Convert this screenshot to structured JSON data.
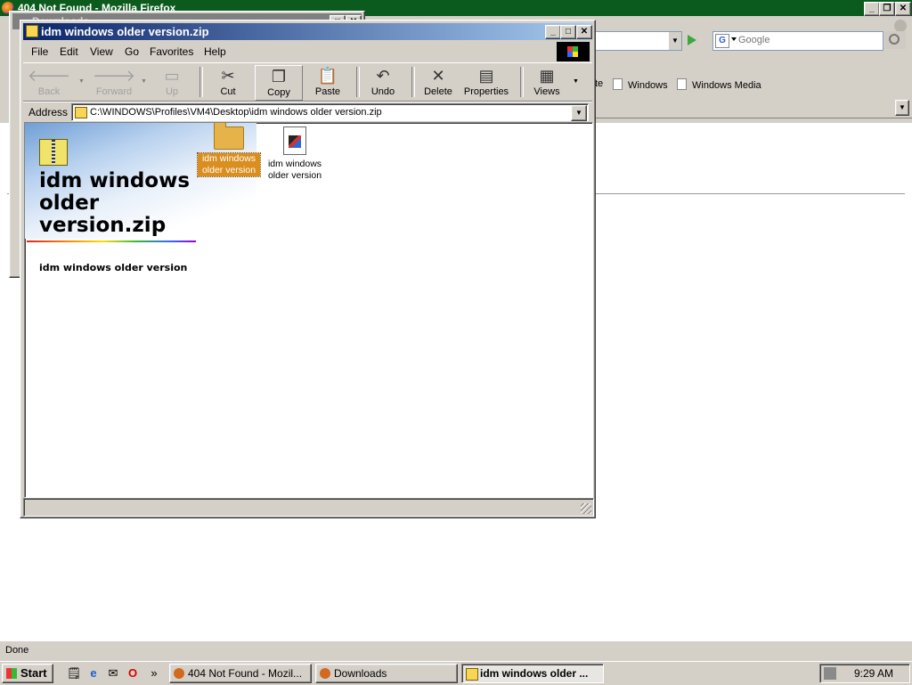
{
  "firefox": {
    "title": "404 Not Found - Mozilla Firefox",
    "search_placeholder": "Google",
    "bookmarks": [
      "Windows",
      "Windows Media"
    ],
    "bookmark_cut": "te",
    "status": "Done"
  },
  "downloads_window": {
    "title": "Downloads"
  },
  "explorer": {
    "title": "idm windows older version.zip",
    "menu": [
      "File",
      "Edit",
      "View",
      "Go",
      "Favorites",
      "Help"
    ],
    "toolbar": {
      "back": "Back",
      "forward": "Forward",
      "up": "Up",
      "cut": "Cut",
      "copy": "Copy",
      "paste": "Paste",
      "undo": "Undo",
      "delete": "Delete",
      "properties": "Properties",
      "views": "Views"
    },
    "address_label": "Address",
    "address_value": "C:\\WINDOWS\\Profiles\\VM4\\Desktop\\idm windows older version.zip",
    "side_title": "idm windows older version.zip",
    "side_description": "idm windows older version",
    "items": [
      {
        "name": "idm windows older version",
        "type": "folder",
        "selected": true
      },
      {
        "name": "idm windows older version",
        "type": "file",
        "selected": false
      }
    ]
  },
  "taskbar": {
    "start": "Start",
    "tasks": [
      "404 Not Found - Mozil...",
      "Downloads",
      "idm windows older ..."
    ],
    "clock": "9:29 AM"
  }
}
